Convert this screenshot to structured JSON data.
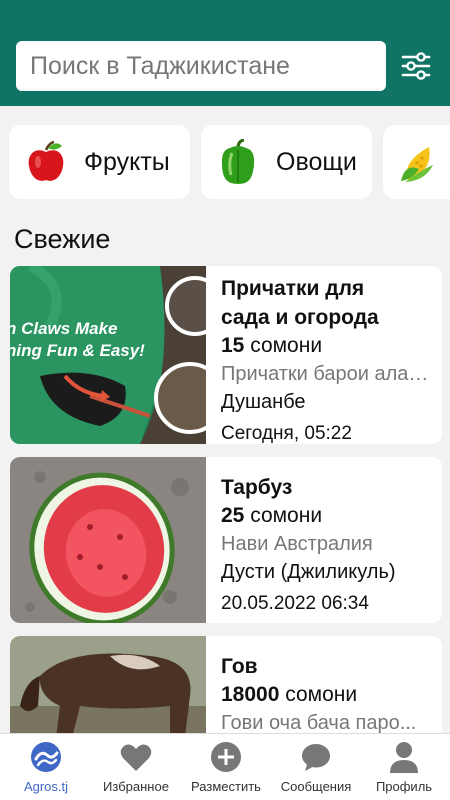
{
  "search": {
    "placeholder": "Поиск в Таджикистане",
    "value": ""
  },
  "categories": [
    {
      "label": "Фрукты",
      "icon": "apple-icon"
    },
    {
      "label": "Овощи",
      "icon": "pepper-icon"
    },
    {
      "label": "",
      "icon": "corn-icon"
    }
  ],
  "section_title": "Свежие",
  "listings": [
    {
      "title_lines": [
        "Причатки для",
        "сада и огорода"
      ],
      "price_value": "15",
      "price_currency": "сомони",
      "description": "Причатки барои алаф...",
      "location": "Душанбе",
      "date": "Сегодня, 05:22",
      "image_caption": [
        "n Claws Make",
        "ning Fun & Easy!"
      ]
    },
    {
      "title_lines": [
        "Тарбуз"
      ],
      "price_value": "25",
      "price_currency": "сомони",
      "description": "Нави Австралия",
      "location": "Дусти (Джиликуль)",
      "date": "20.05.2022 06:34"
    },
    {
      "title_lines": [
        "Гов"
      ],
      "price_value": "18000",
      "price_currency": "сомони",
      "description": "Гови оча бача паро..."
    }
  ],
  "bottom_nav": [
    {
      "label": "Agros.tj",
      "icon": "agros-logo-icon",
      "active": true
    },
    {
      "label": "Избранное",
      "icon": "heart-icon"
    },
    {
      "label": "Разместить",
      "icon": "plus-circle-icon"
    },
    {
      "label": "Сообщения",
      "icon": "chat-icon"
    },
    {
      "label": "Профиль",
      "icon": "person-icon"
    }
  ],
  "colors": {
    "header": "#0f7466",
    "background": "#f2f2f2",
    "active_nav": "#3f67c6",
    "nav_icon": "#777777"
  }
}
